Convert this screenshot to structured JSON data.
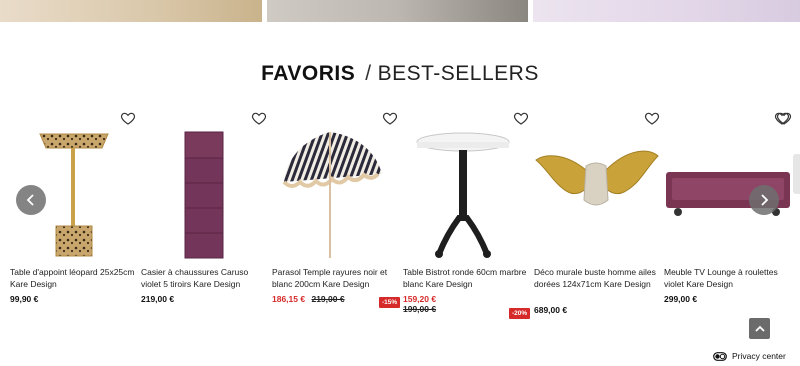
{
  "section": {
    "title_strong": "FAVORIS",
    "title_separator": "/",
    "title_light": "BEST-SELLERS"
  },
  "products": [
    {
      "name": "Table d'appoint léopard 25x25cm Kare Design",
      "price": "99,90 €",
      "old_price": "",
      "badge": "",
      "icon": "heart-outline-icon"
    },
    {
      "name": "Casier à chaussures Caruso violet 5 tiroirs Kare Design",
      "price": "219,00 €",
      "old_price": "",
      "badge": "",
      "icon": "heart-outline-icon"
    },
    {
      "name": "Parasol Temple rayures noir et blanc 200cm Kare Design",
      "price": "186,15 €",
      "old_price": "219,00 €",
      "badge": "-15%",
      "icon": "heart-outline-icon"
    },
    {
      "name": "Table Bistrot ronde 60cm marbre blanc Kare Design",
      "price": "159,20 €",
      "old_price": "199,00 €",
      "badge": "-20%",
      "icon": "heart-outline-icon"
    },
    {
      "name": "Déco murale buste homme ailes dorées 124x71cm Kare Design",
      "price": "689,00 €",
      "old_price": "",
      "badge": "",
      "icon": "heart-outline-icon"
    },
    {
      "name": "Meuble TV Lounge à roulettes violet Kare Design",
      "price": "299,00 €",
      "old_price": "",
      "badge": "",
      "icon": "heart-outline-icon"
    }
  ],
  "carousel": {
    "prev_icon": "chevron-left-icon",
    "next_icon": "chevron-right-icon"
  },
  "footer": {
    "privacy_label": "Privacy center",
    "scroll_top_icon": "chevron-up-icon"
  },
  "colors": {
    "sale": "#d62a2a",
    "nav_button": "#6e6e6e"
  }
}
